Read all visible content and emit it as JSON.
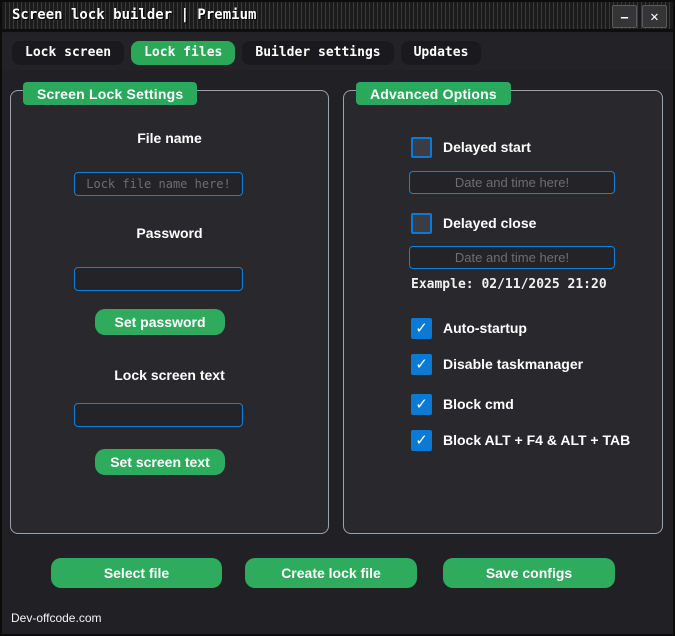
{
  "window": {
    "title": "Screen lock builder | Premium",
    "minimize_glyph": "–",
    "close_glyph": "✕"
  },
  "tabs": [
    {
      "label": "Lock screen",
      "active": false
    },
    {
      "label": "Lock files",
      "active": true
    },
    {
      "label": "Builder settings",
      "active": false
    },
    {
      "label": "Updates",
      "active": false
    }
  ],
  "left_panel": {
    "header": "Screen Lock Settings",
    "file_name_label": "File name",
    "file_name_value": "",
    "file_name_placeholder": "Lock file name here!",
    "password_label": "Password",
    "password_value": "",
    "set_password_button": "Set password",
    "lock_screen_text_label": "Lock screen text",
    "lock_screen_text_value": "",
    "set_screen_text_button": "Set screen text"
  },
  "right_panel": {
    "header": "Advanced Options",
    "delayed_start": {
      "label": "Delayed start",
      "checked": false,
      "value": "",
      "placeholder": "Date and time here!"
    },
    "delayed_close": {
      "label": "Delayed close",
      "checked": false,
      "value": "",
      "placeholder": "Date and time here!"
    },
    "example_text": "Example: 02/11/2025 21:20",
    "checkboxes": {
      "auto_startup": {
        "label": "Auto-startup",
        "checked": true
      },
      "disable_taskmanager": {
        "label": "Disable taskmanager",
        "checked": true
      },
      "block_cmd": {
        "label": "Block cmd",
        "checked": true
      },
      "block_alt": {
        "label": "Block ALT + F4  &  ALT + TAB",
        "checked": true
      }
    }
  },
  "footer": {
    "select_file_button": "Select file",
    "create_lock_file_button": "Create lock file",
    "save_configs_button": "Save configs",
    "credit": "Dev-offcode.com"
  },
  "colors": {
    "accent_green": "#2fab5e",
    "accent_blue": "#0a7ad4",
    "panel_background": "#28282d",
    "window_background": "#212125"
  }
}
